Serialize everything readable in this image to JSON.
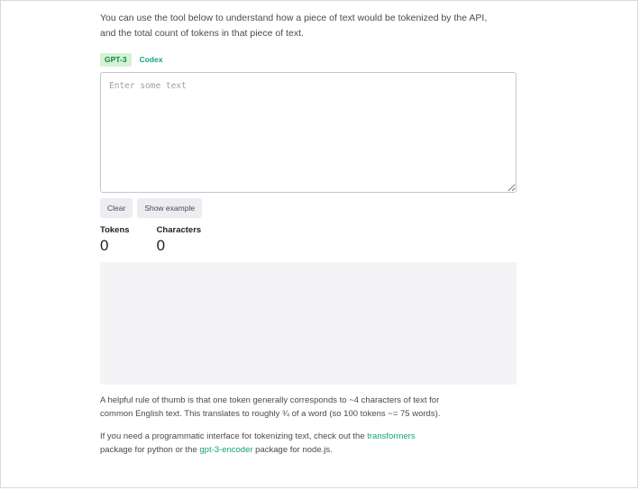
{
  "intro": {
    "line1": "You can use the tool below to understand how a piece of text would be tokenized by the API,",
    "line2": "and the total count of tokens in that piece of text."
  },
  "tabs": [
    {
      "label": "GPT-3",
      "active": true
    },
    {
      "label": "Codex",
      "active": false
    }
  ],
  "input": {
    "placeholder": "Enter some text",
    "value": ""
  },
  "buttons": {
    "clear": "Clear",
    "show_example": "Show example"
  },
  "stats": {
    "tokens_label": "Tokens",
    "tokens_value": "0",
    "characters_label": "Characters",
    "characters_value": "0"
  },
  "notes": {
    "rule_line1": "A helpful rule of thumb is that one token generally corresponds to ~4 characters of text for",
    "rule_line2": "common English text. This translates to roughly ¾ of a word (so 100 tokens ~= 75 words).",
    "prog_before": "If you need a programmatic interface for tokenizing text, check out the ",
    "prog_link1": "transformers",
    "prog_middle": "package for python or the ",
    "prog_link2": "gpt-3-encoder",
    "prog_after": " package for node.js."
  },
  "colors": {
    "accent": "#10a37f",
    "tab_active_bg": "#d2f4d3",
    "button_bg": "#ececf1",
    "panel_bg": "#f4f4f6"
  }
}
